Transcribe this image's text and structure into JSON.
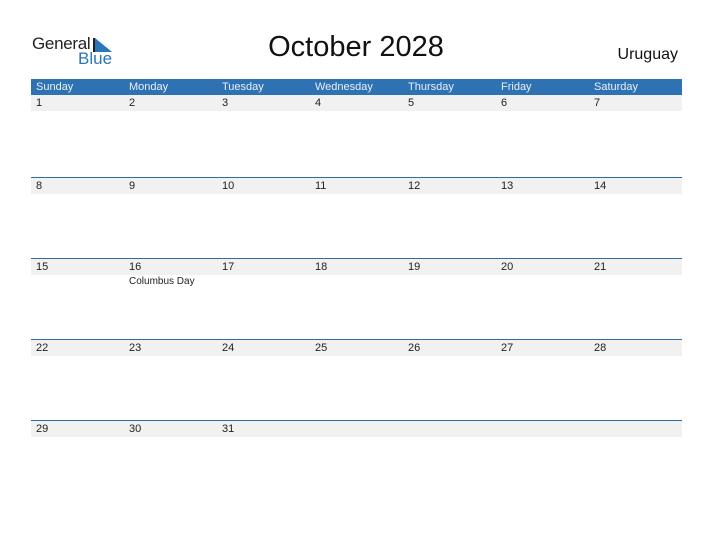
{
  "logo": {
    "line1": "General",
    "line2": "Blue"
  },
  "title": "October 2028",
  "country": "Uruguay",
  "colors": {
    "header_bg": "#2e72b4",
    "accent": "#2b76b9",
    "row_bg": "#f1f1f1"
  },
  "weekdays": [
    "Sunday",
    "Monday",
    "Tuesday",
    "Wednesday",
    "Thursday",
    "Friday",
    "Saturday"
  ],
  "weeks": [
    {
      "days": [
        "1",
        "2",
        "3",
        "4",
        "5",
        "6",
        "7"
      ],
      "events": [
        "",
        "",
        "",
        "",
        "",
        "",
        ""
      ]
    },
    {
      "days": [
        "8",
        "9",
        "10",
        "11",
        "12",
        "13",
        "14"
      ],
      "events": [
        "",
        "",
        "",
        "",
        "",
        "",
        ""
      ]
    },
    {
      "days": [
        "15",
        "16",
        "17",
        "18",
        "19",
        "20",
        "21"
      ],
      "events": [
        "",
        "Columbus Day",
        "",
        "",
        "",
        "",
        ""
      ]
    },
    {
      "days": [
        "22",
        "23",
        "24",
        "25",
        "26",
        "27",
        "28"
      ],
      "events": [
        "",
        "",
        "",
        "",
        "",
        "",
        ""
      ]
    },
    {
      "days": [
        "29",
        "30",
        "31",
        "",
        "",
        "",
        ""
      ],
      "events": [
        "",
        "",
        "",
        "",
        "",
        "",
        ""
      ]
    }
  ]
}
